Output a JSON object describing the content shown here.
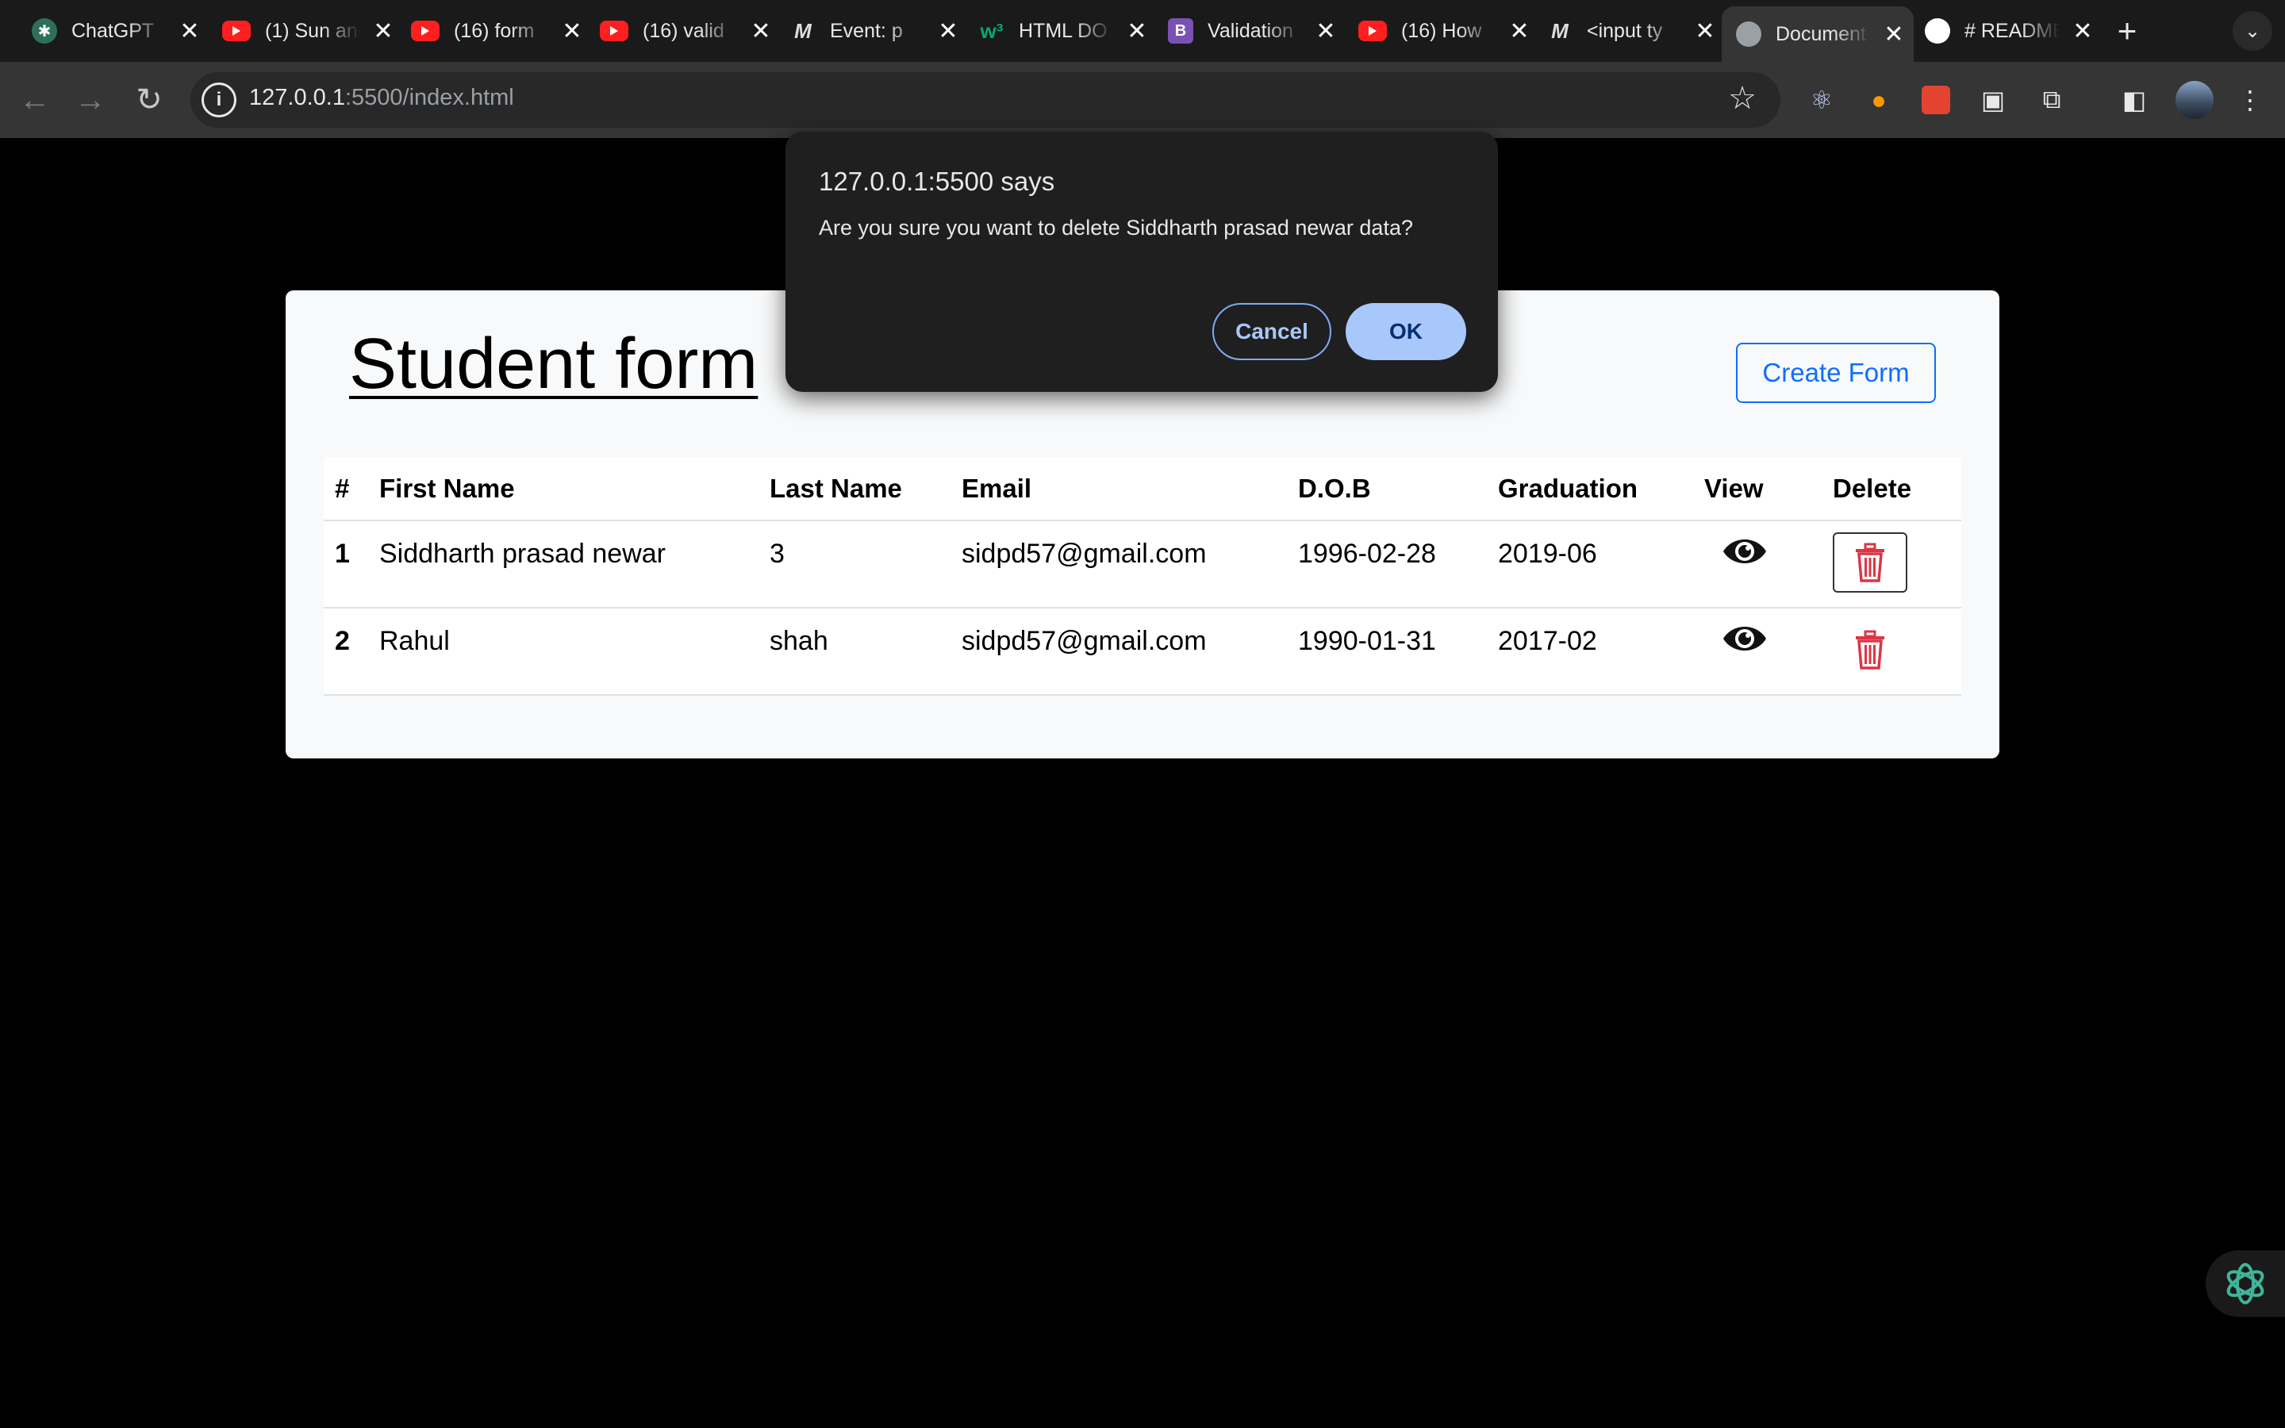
{
  "browser": {
    "tabs": [
      {
        "title": "ChatGPT",
        "icon": "chatgpt-icon"
      },
      {
        "title": "(1) Sun and",
        "icon": "youtube-icon"
      },
      {
        "title": "(16) form",
        "icon": "youtube-icon"
      },
      {
        "title": "(16) valid",
        "icon": "youtube-icon"
      },
      {
        "title": "Event: p",
        "icon": "mdn-icon"
      },
      {
        "title": "HTML DO",
        "icon": "w3schools-icon"
      },
      {
        "title": "Validation",
        "icon": "bootstrap-icon"
      },
      {
        "title": "(16) How",
        "icon": "youtube-icon"
      },
      {
        "title": "<input ty",
        "icon": "mdn-icon"
      },
      {
        "title": "Document",
        "icon": "globe-icon",
        "active": true
      },
      {
        "title": "# README",
        "icon": "github-icon"
      }
    ],
    "url_host": "127.0.0.1",
    "url_rest": ":5500/index.html"
  },
  "page": {
    "title": "Student form",
    "create_button": "Create Form",
    "table": {
      "headers": [
        "#",
        "First Name",
        "Last Name",
        "Email",
        "D.O.B",
        "Graduation",
        "View",
        "Delete"
      ],
      "rows": [
        {
          "num": "1",
          "first": "Siddharth prasad newar",
          "last": "3",
          "email": "sidpd57@gmail.com",
          "dob": "1996-02-28",
          "grad": "2019-06"
        },
        {
          "num": "2",
          "first": "Rahul",
          "last": "shah",
          "email": "sidpd57@gmail.com",
          "dob": "1990-01-31",
          "grad": "2017-02"
        }
      ]
    }
  },
  "dialog": {
    "title": "127.0.0.1:5500 says",
    "message": "Are you sure you want to delete Siddharth prasad newar data?",
    "cancel": "Cancel",
    "ok": "OK"
  },
  "colors": {
    "accent": "#0d6efd",
    "delete": "#dc3545",
    "dialog_ok": "#a8c7fa"
  }
}
